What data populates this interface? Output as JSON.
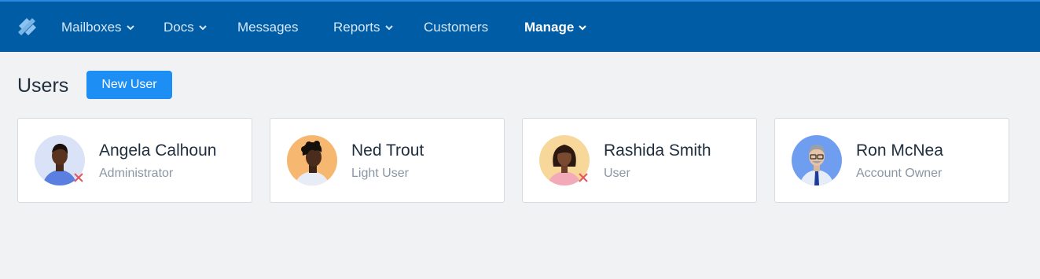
{
  "nav": {
    "logo_icon": "helpscout-logo-icon",
    "items": [
      {
        "label": "Mailboxes",
        "has_dropdown": true
      },
      {
        "label": "Docs",
        "has_dropdown": true
      },
      {
        "label": "Messages",
        "has_dropdown": false
      },
      {
        "label": "Reports",
        "has_dropdown": true
      },
      {
        "label": "Customers",
        "has_dropdown": false
      },
      {
        "label": "Manage",
        "has_dropdown": true,
        "active": true
      }
    ]
  },
  "page": {
    "title": "Users",
    "new_user_label": "New User"
  },
  "users": [
    {
      "name": "Angela Calhoun",
      "role": "Administrator",
      "avatar_bg": "#d9e2f6",
      "status_icon": "x-icon"
    },
    {
      "name": "Ned Trout",
      "role": "Light User",
      "avatar_bg": "#f6b870",
      "status_icon": null
    },
    {
      "name": "Rashida Smith",
      "role": "User",
      "avatar_bg": "#f8d79a",
      "status_icon": "x-icon"
    },
    {
      "name": "Ron McNea",
      "role": "Account Owner",
      "avatar_bg": "#6f9ef0",
      "status_icon": null
    }
  ],
  "colors": {
    "nav_bg": "#005ca4",
    "accent": "#1c8ef4",
    "status_x": "#e5545a"
  }
}
